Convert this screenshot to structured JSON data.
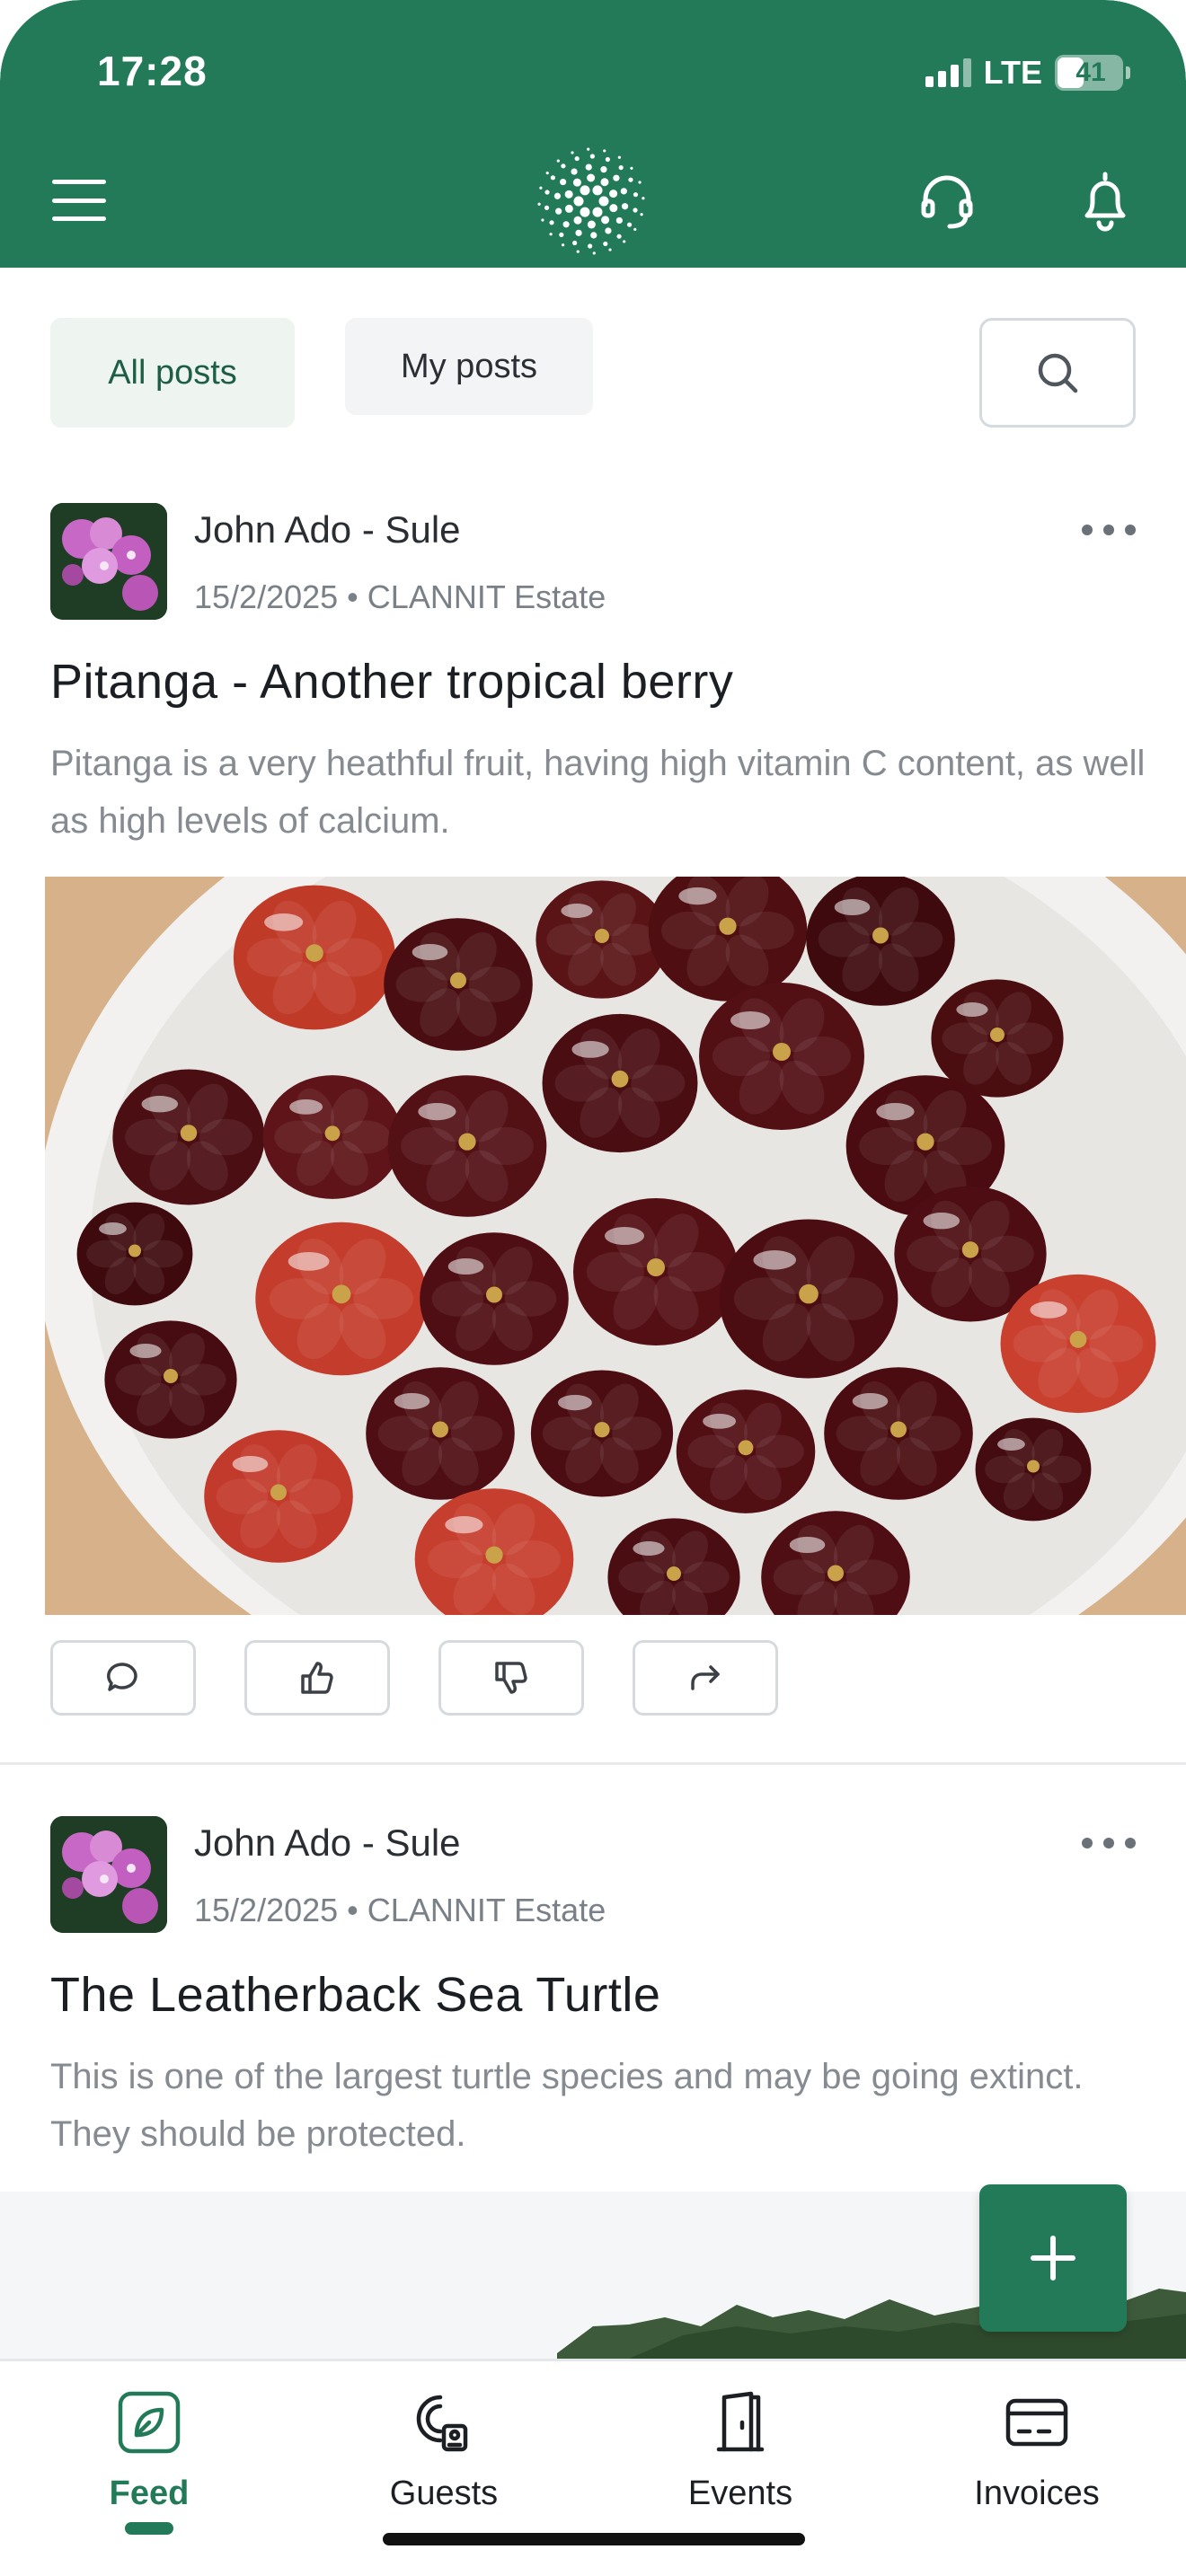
{
  "status_bar": {
    "time": "17:28",
    "network": "LTE",
    "battery": "41",
    "battery_level": 0.41
  },
  "header": {
    "menu_icon": "hamburger-menu-icon",
    "logo_icon": "dotted-circle-logo",
    "support_icon": "headset-icon",
    "notifications_icon": "bell-icon"
  },
  "filters": {
    "all_posts": "All posts",
    "my_posts": "My posts",
    "active": "All posts",
    "search_icon": "search-icon"
  },
  "posts": [
    {
      "author": "John Ado - Sule",
      "date": "15/2/2025",
      "separator": "•",
      "location": "CLANNIT Estate",
      "title": "Pitanga - Another tropical berry",
      "body": "Pitanga is a very heathful fruit, having high vitamin C content, as well as high levels of calcium.",
      "image": "bowl-of-pitanga-berries",
      "actions": [
        "comment-icon",
        "thumbs-up-icon",
        "thumbs-down-icon",
        "share-icon"
      ]
    },
    {
      "author": "John Ado - Sule",
      "date": "15/2/2025",
      "separator": "•",
      "location": "CLANNIT Estate",
      "title": "The Leatherback Sea Turtle",
      "body": "This is one of the largest turtle species and may be going extinct.  They should be protected.",
      "image": "treeline-landscape"
    }
  ],
  "fab": {
    "icon": "plus-icon"
  },
  "bottom_nav": [
    {
      "label": "Feed",
      "icon": "leaf-icon",
      "active": true
    },
    {
      "label": "Guests",
      "icon": "guest-pass-icon",
      "active": false
    },
    {
      "label": "Events",
      "icon": "door-icon",
      "active": false
    },
    {
      "label": "Invoices",
      "icon": "card-icon",
      "active": false
    }
  ],
  "colors": {
    "brand": "#237a59",
    "active_filter_bg": "#eef5f1",
    "muted_text": "#858b91"
  }
}
